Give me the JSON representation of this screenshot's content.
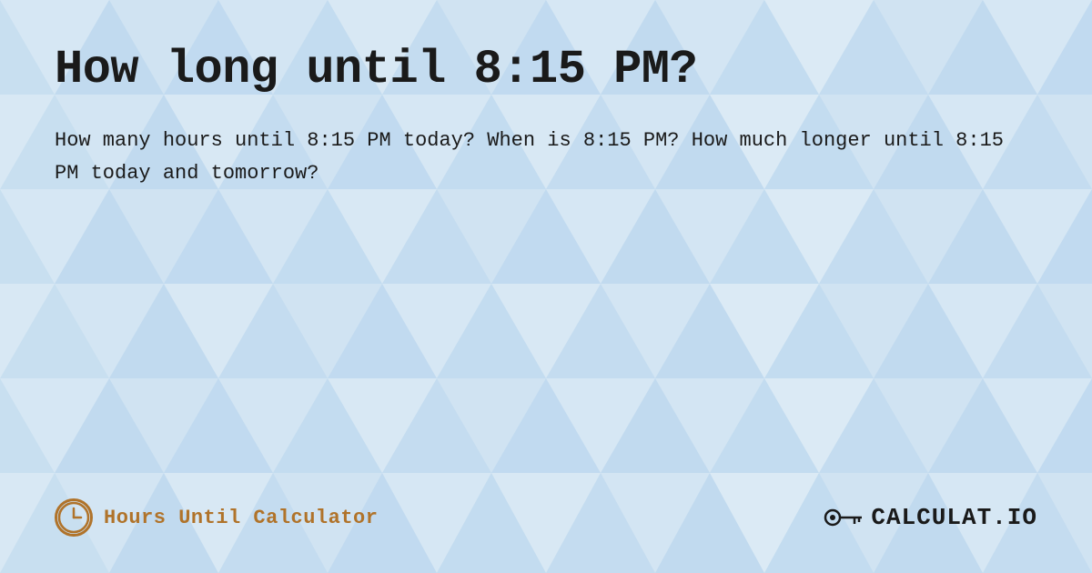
{
  "page": {
    "title": "How long until 8:15 PM?",
    "description": "How many hours until 8:15 PM today? When is 8:15 PM? How much longer until 8:15 PM today and tomorrow?",
    "background_color": "#c8dff0"
  },
  "footer": {
    "brand_label": "Hours Until Calculator",
    "logo_text": "CALCULAT.IO",
    "clock_icon_label": "clock-icon",
    "logo_hand_icon": "hand-pointing-icon"
  }
}
